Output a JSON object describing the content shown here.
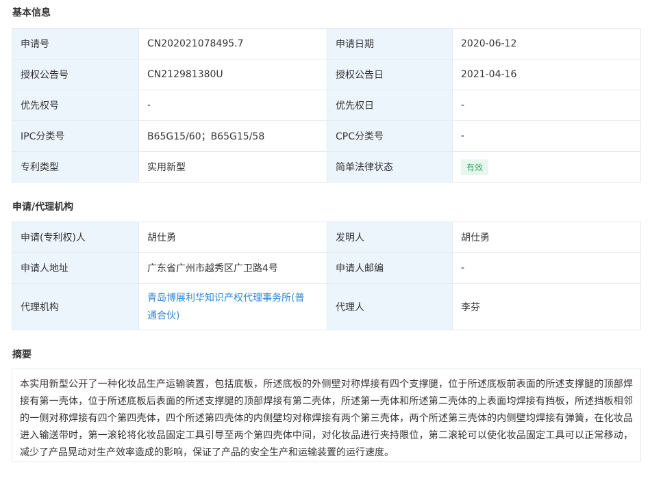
{
  "basic": {
    "title": "基本信息",
    "rows": [
      [
        {
          "label": "申请号",
          "value": "CN202021078495.7"
        },
        {
          "label": "申请日期",
          "value": "2020-06-12"
        }
      ],
      [
        {
          "label": "授权公告号",
          "value": "CN212981380U"
        },
        {
          "label": "授权公告日",
          "value": "2021-04-16"
        }
      ],
      [
        {
          "label": "优先权号",
          "value": "-"
        },
        {
          "label": "优先权日",
          "value": "-"
        }
      ],
      [
        {
          "label": "IPC分类号",
          "value": "B65G15/60；B65G15/58"
        },
        {
          "label": "CPC分类号",
          "value": "-"
        }
      ],
      [
        {
          "label": "专利类型",
          "value": "实用新型"
        },
        {
          "label": "简单法律状态",
          "value": "有效"
        }
      ]
    ]
  },
  "agency": {
    "title": "申请/代理机构",
    "rows": [
      [
        {
          "label": "申请(专利权)人",
          "value": "胡仕勇"
        },
        {
          "label": "发明人",
          "value": "胡仕勇"
        }
      ],
      [
        {
          "label": "申请人地址",
          "value": "广东省广州市越秀区广卫路4号"
        },
        {
          "label": "申请人邮编",
          "value": "-"
        }
      ],
      [
        {
          "label": "代理机构",
          "value_line1": "青岛博展利华知识产权代理事务所(普",
          "value_line2": "通合伙)"
        },
        {
          "label": "代理人",
          "value": "李芬"
        }
      ]
    ]
  },
  "abstract": {
    "title": "摘要",
    "text": "本实用新型公开了一种化妆品生产运输装置，包括底板，所述底板的外侧壁对称焊接有四个支撑腿，位于所述底板前表面的所述支撑腿的顶部焊接有第一壳体，位于所述底板后表面的所述支撑腿的顶部焊接有第二壳体，所述第一壳体和所述第二壳体的上表面均焊接有挡板，所述挡板相邻的一侧对称焊接有四个第四壳体，四个所述第四壳体的内侧壁均对称焊接有两个第三壳体，两个所述第三壳体的内侧壁均焊接有弹簧，在化妆品进入输送带时，第一滚轮将化妆品固定工具引导至两个第四壳体中间，对化妆品进行夹持限位，第二滚轮可以使化妆品固定工具可以正常移动，减少了产品晃动对生产效率造成的影响，保证了产品的安全生产和运输装置的运行速度。"
  },
  "colors": {
    "label_bg": "#edf5fc",
    "border": "#e4e9ef",
    "link": "#2d86d6",
    "badge_bg": "#e7f7ee",
    "badge_text": "#3aa869"
  }
}
